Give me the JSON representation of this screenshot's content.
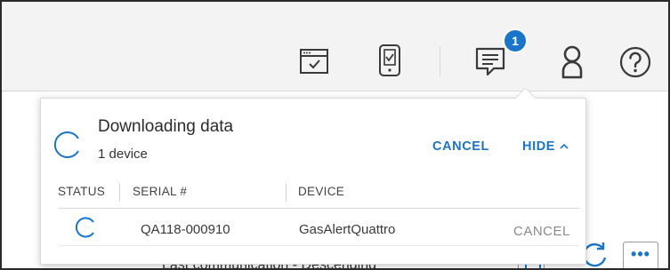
{
  "topbar": {
    "icons": [
      {
        "name": "browser-check-icon"
      },
      {
        "name": "device-check-icon"
      },
      {
        "name": "messages-icon"
      },
      {
        "name": "user-icon"
      },
      {
        "name": "help-icon"
      }
    ],
    "notification_count": "1"
  },
  "background": {
    "sort_label": "Last communication - Descending"
  },
  "popup": {
    "title": "Downloading data",
    "subtitle": "1 device",
    "cancel_label": "CANCEL",
    "hide_label": "HIDE",
    "columns": [
      "STATUS",
      "SERIAL #",
      "DEVICE"
    ],
    "rows": [
      {
        "serial": "QA118-000910",
        "device": "GasAlertQuattro",
        "action": "CANCEL"
      }
    ]
  },
  "colors": {
    "accent": "#1a75c9",
    "topbar_bg": "#f3f3f3",
    "icon_dark": "#3a3a3a",
    "muted_text": "#8a8a8a"
  }
}
